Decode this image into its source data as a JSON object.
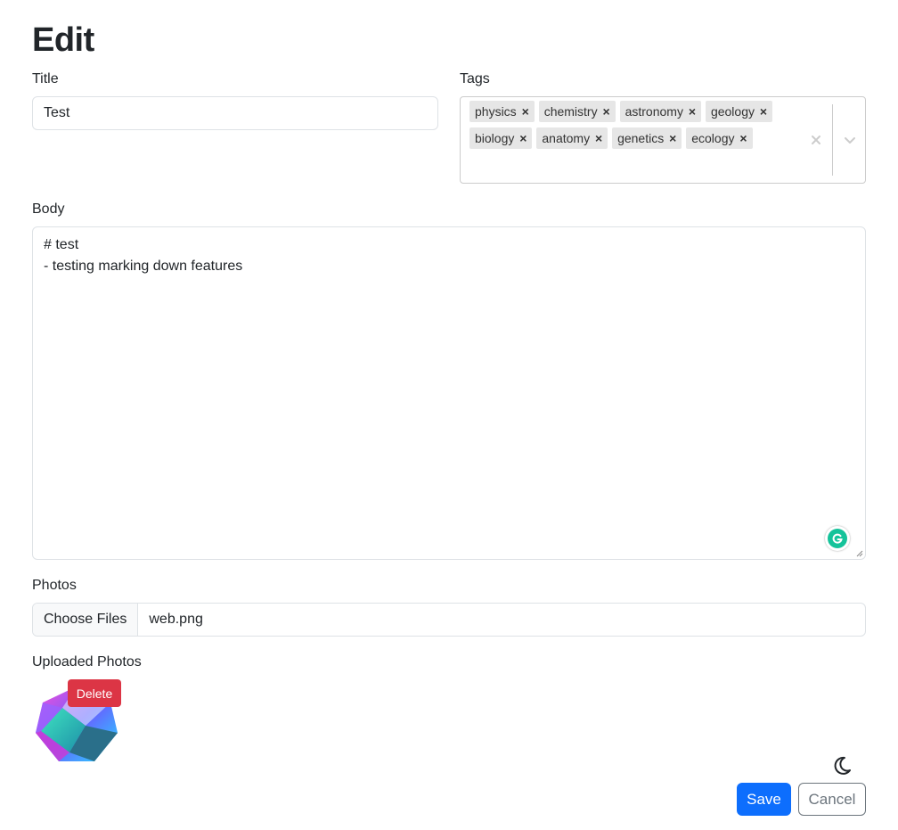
{
  "page": {
    "heading": "Edit"
  },
  "title_field": {
    "label": "Title",
    "value": "Test"
  },
  "tags_field": {
    "label": "Tags",
    "tags": [
      "physics",
      "chemistry",
      "astronomy",
      "geology",
      "biology",
      "anatomy",
      "genetics",
      "ecology"
    ],
    "remove_glyph": "×",
    "clear_icon": "close-icon",
    "dropdown_icon": "chevron-down-icon"
  },
  "body_field": {
    "label": "Body",
    "value": "# test\n- testing marking down features",
    "assistant_icon": "grammarly-icon"
  },
  "photos_field": {
    "label": "Photos",
    "button_label": "Choose Files",
    "file_name": "web.png"
  },
  "uploaded": {
    "label": "Uploaded Photos",
    "delete_label": "Delete"
  },
  "actions": {
    "save_label": "Save",
    "cancel_label": "Cancel",
    "theme_icon": "moon-icon"
  },
  "colors": {
    "primary": "#0d6efd",
    "danger": "#dc3545",
    "secondary": "#6c757d",
    "tag_bg": "#e6e6e6"
  }
}
